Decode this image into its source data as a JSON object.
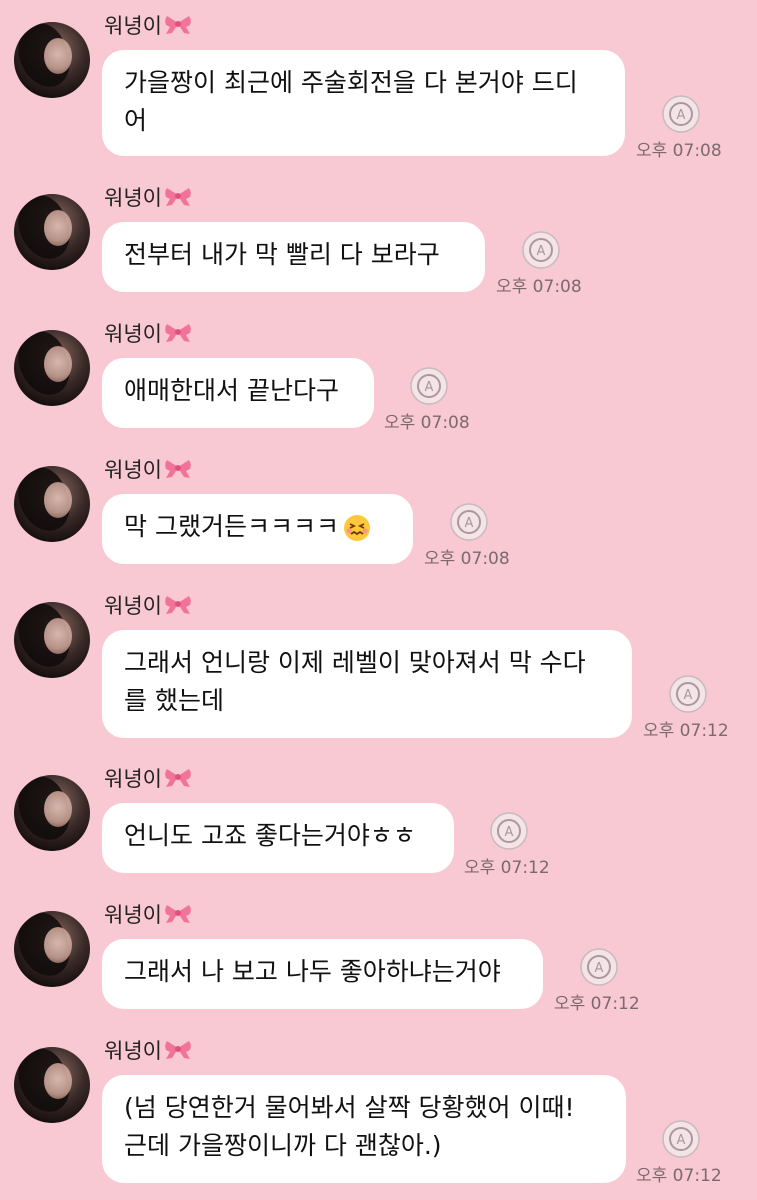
{
  "sender_name": "워녕이",
  "messages": [
    {
      "lines": [
        "가을짱이 최근에 주술회전을 다 본거야 드디",
        "어"
      ],
      "time": "오후 07:08"
    },
    {
      "lines": [
        "전부터 내가 막 빨리 다 보라구"
      ],
      "time": "오후 07:08"
    },
    {
      "lines": [
        "애매한대서 끝난다구"
      ],
      "time": "오후 07:08"
    },
    {
      "lines": [
        "막 그랬거든ㅋㅋㅋㅋ"
      ],
      "emoji": "confounded-face",
      "time": "오후 07:08"
    },
    {
      "lines": [
        "그래서 언니랑 이제 레벨이 맞아져서 막 수다",
        "를 했는데"
      ],
      "time": "오후 07:12"
    },
    {
      "lines": [
        "언니도 고죠 좋다는거야ㅎㅎ"
      ],
      "time": "오후 07:12"
    },
    {
      "lines": [
        "그래서 나 보고 나두 좋아하냐는거야"
      ],
      "time": "오후 07:12"
    },
    {
      "lines": [
        "(넘 당연한거 물어봐서 살짝 당황했어 이때!",
        "근데 가을짱이니까 다 괜찮아.)"
      ],
      "time": "오후 07:12"
    }
  ],
  "icons": {
    "avatar": "profile-photo",
    "name_badge": "ribbon-bow-icon",
    "status": "auto-translate-icon"
  },
  "colors": {
    "background": "#f9c9d3",
    "bubble": "#ffffff",
    "text": "#111111",
    "time": "#7a6a6e"
  }
}
